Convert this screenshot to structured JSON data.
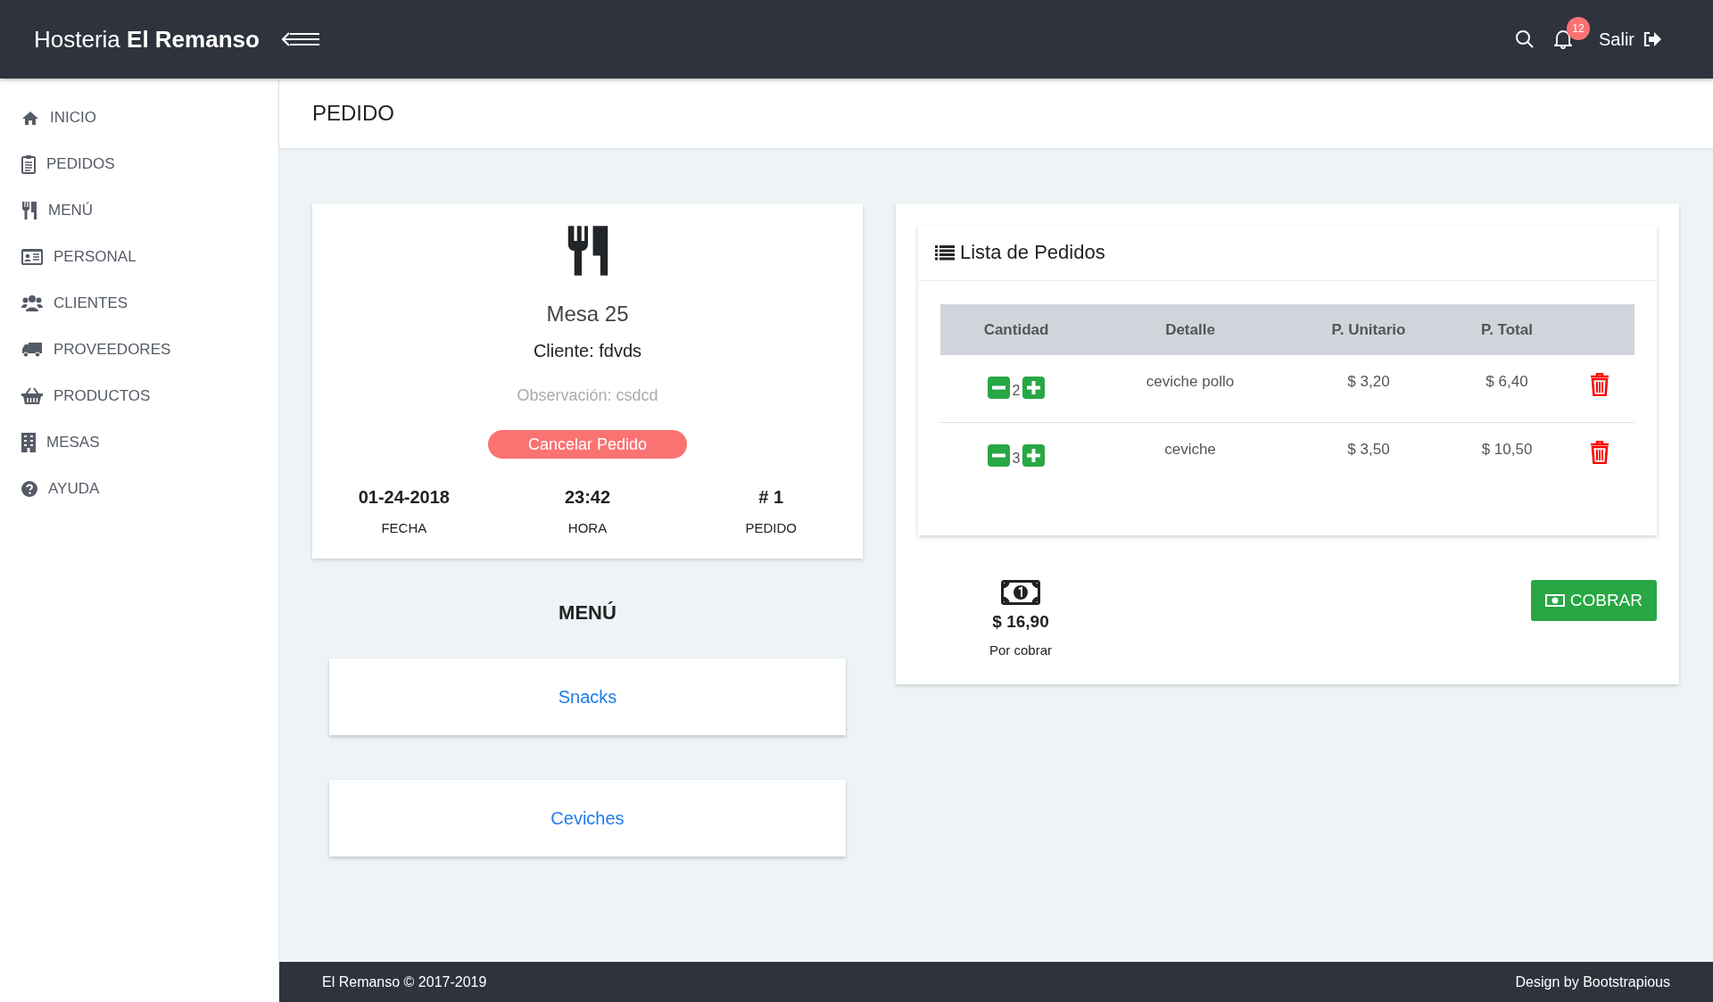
{
  "header": {
    "brand_regular": "Hosteria",
    "brand_bold": "El Remanso",
    "notifications": "12",
    "logout": "Salir"
  },
  "sidebar": {
    "items": [
      {
        "label": "INICIO",
        "kind": "home"
      },
      {
        "label": "PEDIDOS",
        "kind": "clipboard"
      },
      {
        "label": "MENÚ",
        "kind": "utensils"
      },
      {
        "label": "PERSONAL",
        "kind": "idcard"
      },
      {
        "label": "CLIENTES",
        "kind": "users"
      },
      {
        "label": "PROVEEDORES",
        "kind": "truck"
      },
      {
        "label": "PRODUCTOS",
        "kind": "basket"
      },
      {
        "label": "MESAS",
        "kind": "building"
      },
      {
        "label": "AYUDA",
        "kind": "question"
      }
    ]
  },
  "page_title": "PEDIDO",
  "order": {
    "table": "Mesa 25",
    "client": "Cliente: fdvds",
    "note": "Observación: csdcd",
    "cancel": "Cancelar Pedido",
    "facts": [
      {
        "value": "01-24-2018",
        "label": "FECHA"
      },
      {
        "value": "23:42",
        "label": "HORA"
      },
      {
        "value": "# 1",
        "label": "PEDIDO"
      }
    ]
  },
  "menu": {
    "title": "MENÚ",
    "categories": [
      "Snacks",
      "Ceviches"
    ]
  },
  "orders": {
    "title": "Lista de Pedidos",
    "columns": [
      "Cantidad",
      "Detalle",
      "P. Unitario",
      "P. Total"
    ],
    "rows": [
      {
        "quantity": "2",
        "detail": "ceviche pollo",
        "unit": "$ 3,20",
        "total": "$ 6,40"
      },
      {
        "quantity": "3",
        "detail": "ceviche",
        "unit": "$ 3,50",
        "total": "$ 10,50"
      }
    ],
    "total": "$ 16,90",
    "total_label": "Por cobrar",
    "charge": "COBRAR"
  },
  "footer": {
    "left": "El Remanso © 2017-2019",
    "right": "Design by Bootstrapious"
  }
}
